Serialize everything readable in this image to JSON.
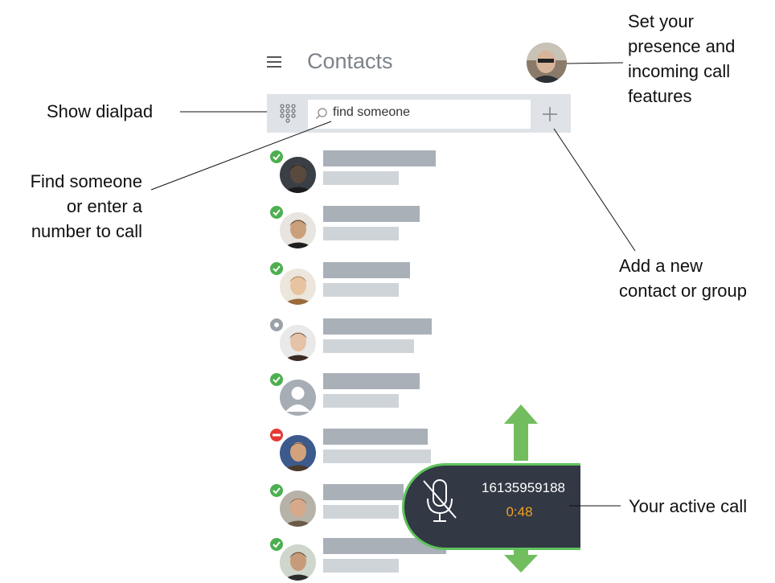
{
  "header": {
    "title": "Contacts"
  },
  "search": {
    "placeholder": "find someone"
  },
  "contacts": [
    {
      "presence": "available",
      "bar1_width": 140,
      "bar2_width": 94
    },
    {
      "presence": "available",
      "bar1_width": 120,
      "bar2_width": 94
    },
    {
      "presence": "available",
      "bar1_width": 108,
      "bar2_width": 94
    },
    {
      "presence": "away",
      "bar1_width": 135,
      "bar2_width": 113
    },
    {
      "presence": "available",
      "bar1_width": 120,
      "bar2_width": 94
    },
    {
      "presence": "busy",
      "bar1_width": 130,
      "bar2_width": 134
    },
    {
      "presence": "available",
      "bar1_width": 100,
      "bar2_width": 94
    },
    {
      "presence": "available",
      "bar1_width": 153,
      "bar2_width": 94
    }
  ],
  "active_call": {
    "number": "16135959188",
    "timer": "0:48"
  },
  "annotations": {
    "dialpad": "Show dialpad",
    "find": [
      "Find someone",
      "or enter a",
      "number to call"
    ],
    "presence": [
      "Set your",
      "presence and",
      "incoming call",
      "features"
    ],
    "add": [
      "Add a new",
      "contact or group"
    ],
    "call": "Your active call"
  },
  "colors": {
    "available": "#4caf50",
    "away": "#9aa1a8",
    "busy": "#e53935",
    "call_border": "#5fc25c",
    "call_bg": "#323844",
    "timer": "#f1a11f",
    "arrow": "#72bd5e"
  },
  "icons": [
    "hamburger-icon",
    "dialpad-icon",
    "search-icon",
    "plus-icon",
    "mic-muted-icon",
    "arrow-up-icon",
    "arrow-down-icon"
  ]
}
